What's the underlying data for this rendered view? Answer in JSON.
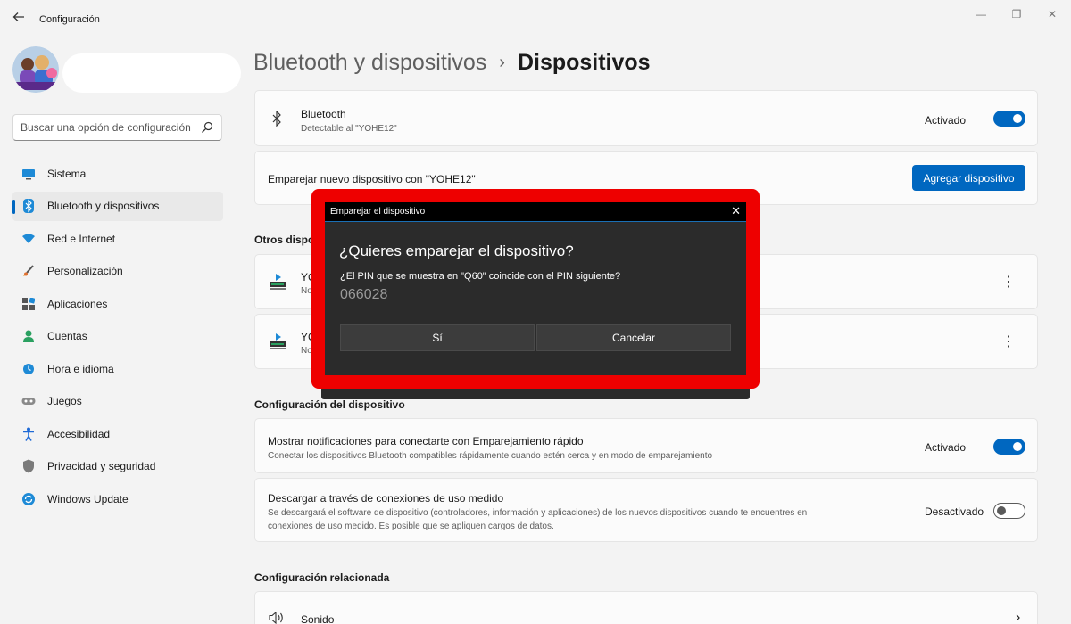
{
  "window": {
    "title": "Configuración",
    "controls": {
      "minimize": "—",
      "maximize": "❐",
      "close": "✕"
    }
  },
  "sidebar": {
    "search_placeholder": "Buscar una opción de configuración",
    "items": [
      {
        "label": "Sistema",
        "icon": "monitor-icon",
        "active": false
      },
      {
        "label": "Bluetooth y dispositivos",
        "icon": "bluetooth-icon",
        "active": true
      },
      {
        "label": "Red e Internet",
        "icon": "wifi-icon",
        "active": false
      },
      {
        "label": "Personalización",
        "icon": "brush-icon",
        "active": false
      },
      {
        "label": "Aplicaciones",
        "icon": "apps-icon",
        "active": false
      },
      {
        "label": "Cuentas",
        "icon": "person-icon",
        "active": false
      },
      {
        "label": "Hora e idioma",
        "icon": "globe-clock-icon",
        "active": false
      },
      {
        "label": "Juegos",
        "icon": "gamepad-icon",
        "active": false
      },
      {
        "label": "Accesibilidad",
        "icon": "accessibility-icon",
        "active": false
      },
      {
        "label": "Privacidad y seguridad",
        "icon": "shield-icon",
        "active": false
      },
      {
        "label": "Windows Update",
        "icon": "update-icon",
        "active": false
      }
    ]
  },
  "breadcrumb": {
    "parent": "Bluetooth y dispositivos",
    "separator": "›",
    "current": "Dispositivos"
  },
  "bluetooth_card": {
    "title": "Bluetooth",
    "subtitle": "Detectable al \"YOHE12\"",
    "state": "Activado",
    "on": true
  },
  "pair_card": {
    "text": "Emparejar nuevo dispositivo con \"YOHE12\"",
    "button": "Agregar dispositivo"
  },
  "other_devices": {
    "title": "Otros dispo",
    "devices": [
      {
        "name": "YC",
        "sub": "No"
      },
      {
        "name": "YC",
        "sub": "No"
      }
    ],
    "more_glyph": "⋮"
  },
  "device_config": {
    "title": "Configuración del dispositivo",
    "rows": [
      {
        "title": "Mostrar notificaciones para conectarte con Emparejamiento rápido",
        "subtitle": "Conectar los dispositivos Bluetooth compatibles rápidamente cuando estén cerca y en modo de emparejamiento",
        "state": "Activado",
        "on": true
      },
      {
        "title": "Descargar a través de conexiones de uso medido",
        "subtitle_line1": "Se descargará el software de dispositivo (controladores, información y aplicaciones) de los nuevos dispositivos cuando te encuentres en",
        "subtitle_line2": "conexiones de uso medido. Es posible que se apliquen cargos de datos.",
        "state": "Desactivado",
        "on": false
      }
    ]
  },
  "related": {
    "title": "Configuración relacionada",
    "item": "Sonido",
    "chevron": "›"
  },
  "dialog": {
    "caption": "Emparejar el dispositivo",
    "close": "✕",
    "heading": "¿Quieres emparejar el dispositivo?",
    "question": "¿El PIN que se muestra en \"Q60\" coincide con el PIN siguiente?",
    "pin": "066028",
    "confirm": "Sí",
    "cancel": "Cancelar"
  },
  "colors": {
    "accent": "#0067c0",
    "highlight_frame": "#ee0000",
    "dialog_bg": "#2b2b2b"
  }
}
